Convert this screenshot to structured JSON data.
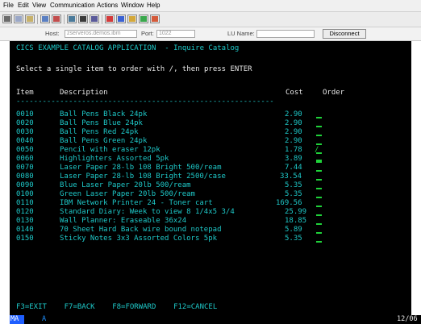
{
  "menu": {
    "items": [
      "File",
      "Edit",
      "View",
      "Communication",
      "Actions",
      "Window",
      "Help"
    ]
  },
  "toolbar": {
    "icons": [
      "print-icon",
      "copy-icon",
      "paste-icon",
      "send-icon",
      "receive-icon",
      "keypad-icon",
      "macro-record-icon",
      "macro-play-icon",
      "color-icon",
      "map-icon",
      "paint-icon",
      "support-icon"
    ]
  },
  "connection": {
    "host_label": "Host:",
    "host_value": "zserveros.demos.ibm",
    "port_label": "Port:",
    "port_value": "1022",
    "lu_label": "LU Name:",
    "lu_value": "",
    "disconnect_label": "Disconnect"
  },
  "screen": {
    "title": "CICS EXAMPLE CATALOG APPLICATION  - Inquire Catalog",
    "instruction": "Select a single item to order with /, then press ENTER",
    "headers": {
      "item": "Item",
      "description": "Description",
      "cost": "Cost",
      "order": "Order"
    },
    "dashes": "-----------------------------------------------------------",
    "rows": [
      {
        "item": "0010",
        "description": "Ball Pens Black 24pk",
        "cost": "2.90",
        "order": ""
      },
      {
        "item": "0020",
        "description": "Ball Pens Blue 24pk",
        "cost": "2.90",
        "order": ""
      },
      {
        "item": "0030",
        "description": "Ball Pens Red 24pk",
        "cost": "2.90",
        "order": ""
      },
      {
        "item": "0040",
        "description": "Ball Pens Green 24pk",
        "cost": "2.90",
        "order": ""
      },
      {
        "item": "0050",
        "description": "Pencil with eraser 12pk",
        "cost": "1.78",
        "order": "/"
      },
      {
        "item": "0060",
        "description": "Highlighters Assorted 5pk",
        "cost": "3.89",
        "order": ""
      },
      {
        "item": "0070",
        "description": "Laser Paper 28-lb 108 Bright 500/ream",
        "cost": "7.44",
        "order": ""
      },
      {
        "item": "0080",
        "description": "Laser Paper 28-lb 108 Bright 2500/case",
        "cost": "33.54",
        "order": ""
      },
      {
        "item": "0090",
        "description": "Blue Laser Paper 20lb 500/ream",
        "cost": "5.35",
        "order": ""
      },
      {
        "item": "0100",
        "description": "Green Laser Paper 20lb 500/ream",
        "cost": "5.35",
        "order": ""
      },
      {
        "item": "0110",
        "description": "IBM Network Printer 24 - Toner cart",
        "cost": "169.56",
        "order": ""
      },
      {
        "item": "0120",
        "description": "Standard Diary: Week to view 8 1/4x5 3/4",
        "cost": "25.99",
        "order": ""
      },
      {
        "item": "0130",
        "description": "Wall Planner: Eraseable 36x24",
        "cost": "18.85",
        "order": ""
      },
      {
        "item": "0140",
        "description": "70 Sheet Hard Back wire bound notepad",
        "cost": "5.89",
        "order": ""
      },
      {
        "item": "0150",
        "description": "Sticky Notes 3x3 Assorted Colors 5pk",
        "cost": "5.35",
        "order": ""
      }
    ],
    "function_keys": "F3=EXIT    F7=BACK    F8=FORWARD    F12=CANCEL"
  },
  "status": {
    "mode": "MA",
    "indicator": "A",
    "cursor_pos": "12/06"
  },
  "colors": {
    "terminal_bg": "#000000",
    "protected_text": "#1ec8c8",
    "input_text": "#1fd23a",
    "status_mode_bg": "#1e5eff"
  }
}
